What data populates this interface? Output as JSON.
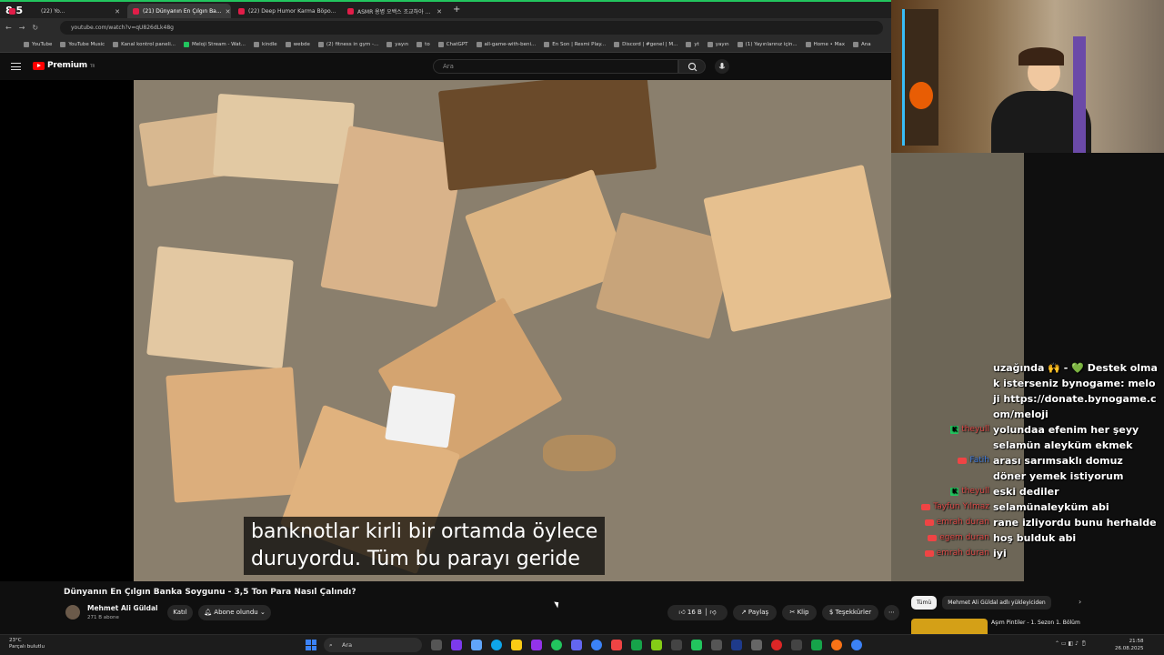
{
  "tabs": [
    {
      "label": "(22) Yo..."
    },
    {
      "label": "(21) Dünyanın En Çılgın Ba...",
      "active": true
    },
    {
      "label": "(22) Deep Humor Karma Böpo..."
    },
    {
      "label": "ASMR 용병 오백스 조교하아 ..."
    }
  ],
  "overlay_counter": "8  5",
  "address": {
    "url": "youtube.com/watch?v=qU826dLk48g"
  },
  "bookmarks": [
    "YouTube",
    "YouTube Music",
    "Kanal kontrol paneli...",
    "Meloji Stream - Wat...",
    "kindle",
    "webde",
    "(2) fitness in gym -...",
    "yayın",
    "to",
    "ChatGPT",
    "all-game-with-beni...",
    "En Son | Resmi Play...",
    "Discord | #genel | M...",
    "yt",
    "yayın",
    "(1) Yayınlarınız için...",
    "Home • Max",
    "Ana"
  ],
  "youtube": {
    "logo_text": "Premium",
    "logo_sup": "TR",
    "search_placeholder": "Ara"
  },
  "video": {
    "subtitle_line1": "banknotlar kirli bir ortamda öylece",
    "subtitle_line2": "duruyordu. Tüm bu parayı geride",
    "title": "Dünyanın En Çılgın Banka Soygunu - 3,5 Ton Para Nasıl Çalındı?",
    "channel": "Mehmet Ali Güldal",
    "subscribers": "271 B abone",
    "join_label": "Katıl",
    "subscribed_label": "Abone olundu",
    "likes": "16 B",
    "share_label": "Paylaş",
    "clip_label": "Klip",
    "thanks_label": "Teşekkürler"
  },
  "recommendations": {
    "chip_all": "Tümü",
    "chip_channel": "Mehmet Ali Güldal adlı yükleyiciden",
    "first_title": "Aşım Pintiler - 1. Sezon 1. Bölüm"
  },
  "chat": [
    {
      "platform": "none",
      "user": "",
      "text": "uzağında 🙌 - 💚 Destek olmak isterseniz bynogame: meloji https://donate.bynogame.com/meloji"
    },
    {
      "platform": "kick",
      "user": "theyull",
      "text": "yolundaa efenim her şeyy"
    },
    {
      "platform": "youtube",
      "user": "Fatih",
      "text": "selamün aleyküm ekmek arası sarımsaklı domuz döner yemek istiyorum"
    },
    {
      "platform": "kick",
      "user": "theyull",
      "text": "eski dediler"
    },
    {
      "platform": "youtube",
      "user": "Tayfun Yılmaz",
      "text": "selamünaleyküm abi"
    },
    {
      "platform": "youtube",
      "user": "emrah duran",
      "text": "rane izliyordu bunu herhalde"
    },
    {
      "platform": "youtube",
      "user": "egem duran",
      "text": "hoş bulduk abi"
    },
    {
      "platform": "youtube",
      "user": "emrah duran",
      "text": "iyi"
    }
  ],
  "taskbar": {
    "weather_temp": "23°C",
    "weather_desc": "Parçalı bulutlu",
    "search_label": "Ara",
    "time": "21:58",
    "date": "26.08.2025"
  }
}
